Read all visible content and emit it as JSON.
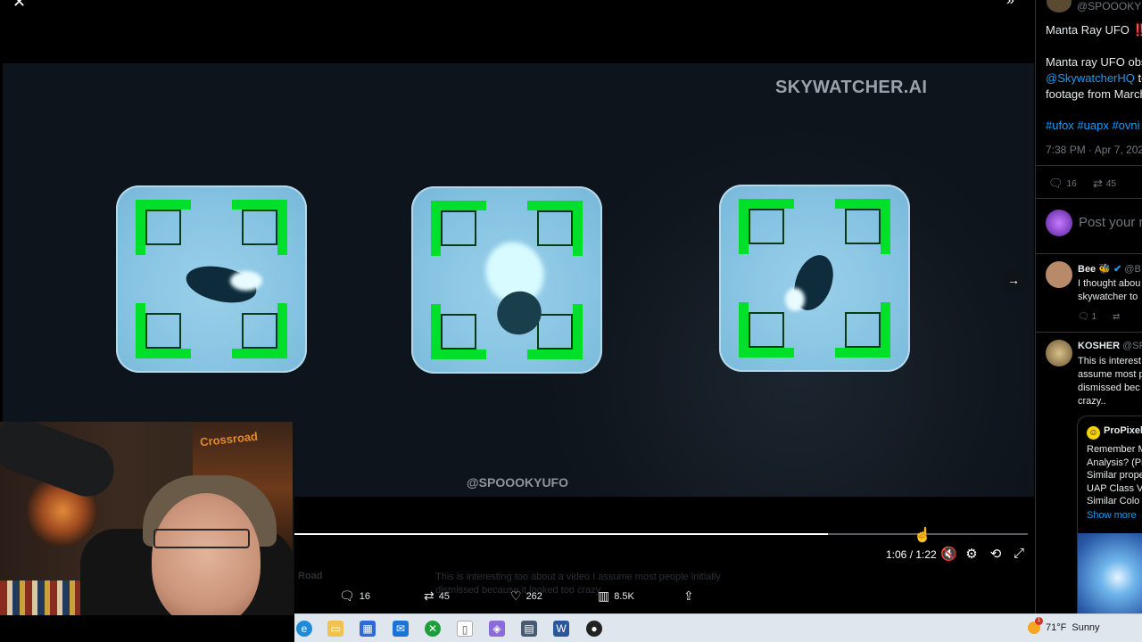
{
  "viewer": {
    "close_icon": "close-icon",
    "expand_icon": "chevron-double-right-icon",
    "video": {
      "brand_watermark": "SKYWATCHER.AI",
      "handle_watermark": "@SPOOOKYUFO"
    },
    "player": {
      "time": "1:06 / 1:22",
      "progress": 0.728,
      "controls": [
        "mute-icon",
        "settings-icon",
        "loop-icon",
        "fullscreen-icon"
      ]
    },
    "post_actions": {
      "replies": "16",
      "reposts": "45",
      "likes": "262",
      "views": "8.5K"
    },
    "background_text": {
      "name": "Road",
      "snippet": "This is interesting too about a video I assume most people initially dismissed because it looked too crazy.."
    }
  },
  "webcam": {
    "poster_text": "Crossroad"
  },
  "post": {
    "handle": "@SPOOOKYU",
    "title": "Manta Ray UFO ‼️",
    "body_line1": "Manta ray UFO obs",
    "mention": "@SkywatcherHQ",
    "mention_suffix": " te",
    "body_line3": "footage from March",
    "hashtags": "#ufox #uapx #ovni",
    "timestamp": "7:38 PM · Apr 7, 2025",
    "stats": {
      "replies": "16",
      "reposts": "45"
    },
    "reply_placeholder": "Post your r"
  },
  "comments": [
    {
      "name": "Bee 🐝",
      "handle": "@B",
      "lines": [
        "I thought abou",
        "skywatcher to"
      ],
      "stats": {
        "replies": "1",
        "reposts": ""
      }
    },
    {
      "name": "KOSHER",
      "handle": "@SP",
      "lines": [
        "This is interest",
        "assume most p",
        "dismissed bec",
        "crazy.."
      ]
    }
  ],
  "quote": {
    "name": "ProPixel",
    "lines": [
      "Remember M",
      "Analysis? (Pi",
      "Similar prope",
      "UAP Class V",
      "Similar Colo"
    ],
    "show_more": "Show more"
  },
  "taskbar": {
    "apps": [
      "edge-icon",
      "file-explorer-icon",
      "store-icon",
      "mail-icon",
      "xbox-icon",
      "file-icon",
      "photos-icon",
      "calculator-icon",
      "word-icon",
      "obs-icon"
    ],
    "weather_temp": "71°F",
    "weather_desc": "Sunny",
    "weather_badge": "1"
  },
  "colors": {
    "accent": "#1d9bf0",
    "target_green": "#00e02a",
    "tile_blue": "#86c3e2"
  }
}
